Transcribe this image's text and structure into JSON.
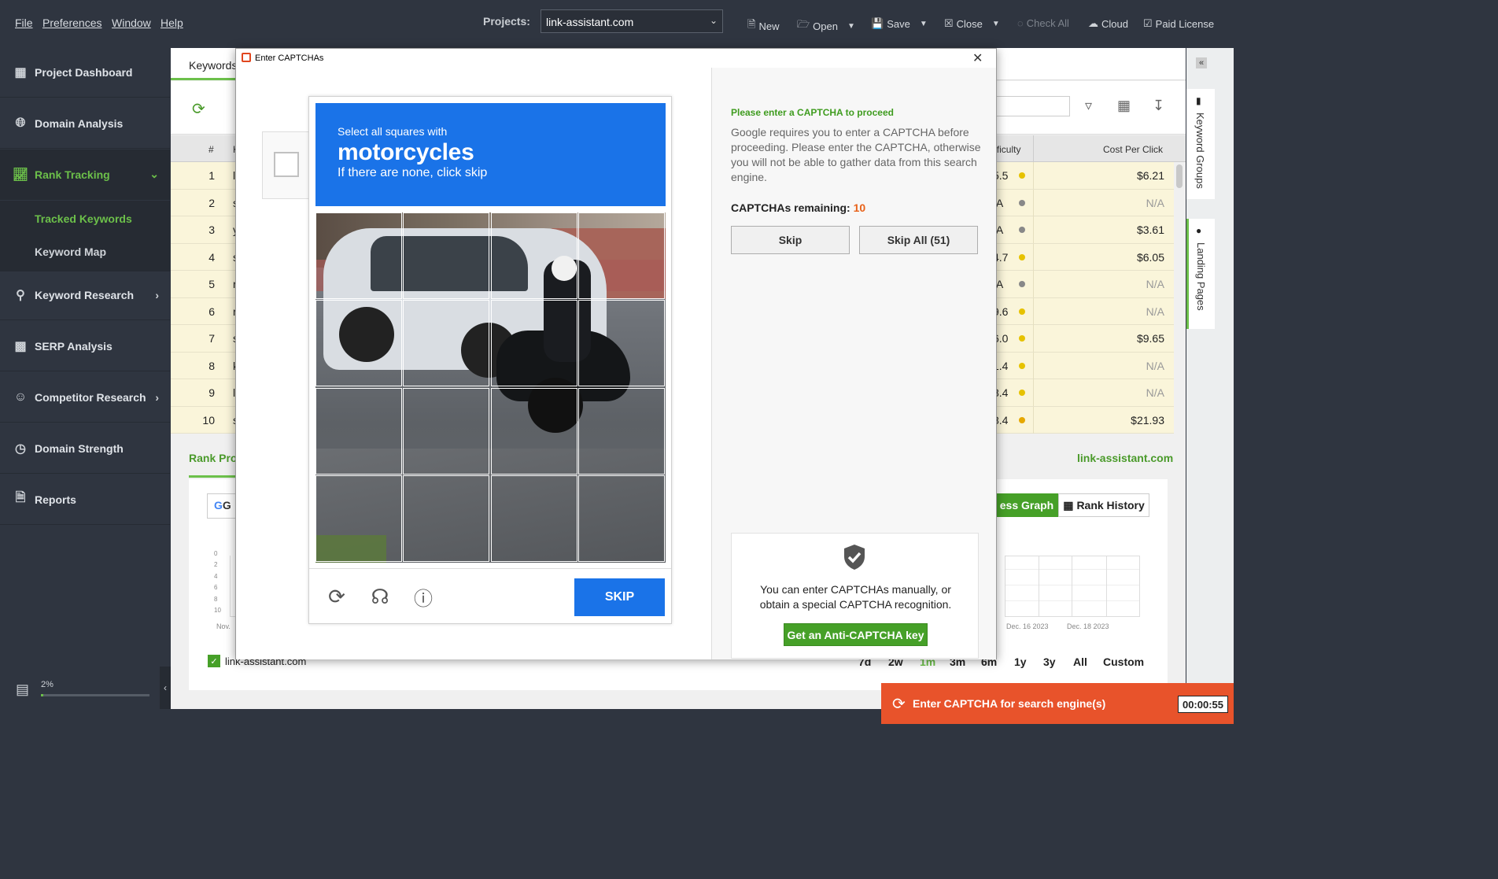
{
  "menu": {
    "file": "File",
    "preferences": "Preferences",
    "window": "Window",
    "help": "Help"
  },
  "projects": {
    "label": "Projects:",
    "value": "link-assistant.com"
  },
  "toolbar": {
    "new": "New",
    "open": "Open",
    "save": "Save",
    "close": "Close",
    "check_all": "Check All",
    "cloud": "Cloud",
    "paid_license": "Paid License"
  },
  "sidebar": {
    "items": [
      {
        "label": "Project Dashboard",
        "icon": "dashboard-icon"
      },
      {
        "label": "Domain Analysis",
        "icon": "globe-icon"
      },
      {
        "label": "Rank Tracking",
        "icon": "chart-line-icon"
      },
      {
        "label": "Keyword Research",
        "icon": "search-icon"
      },
      {
        "label": "SERP Analysis",
        "icon": "bar-chart-icon"
      },
      {
        "label": "Competitor Research",
        "icon": "user-icon"
      },
      {
        "label": "Domain Strength",
        "icon": "gauge-icon"
      },
      {
        "label": "Reports",
        "icon": "report-icon"
      }
    ],
    "sub_items": [
      "Tracked Keywords",
      "Keyword Map"
    ],
    "progress_label": "2%",
    "progress_value": 0.02
  },
  "main": {
    "tab": "Keywords",
    "table": {
      "col_num": "#",
      "col_h": "K",
      "col_difficulty": "ifficulty",
      "col_cpc": "Cost Per Click",
      "rows": [
        {
          "n": "1",
          "k": "l",
          "diff": "5.5",
          "dot": "#e6c200",
          "cpc": "$6.21"
        },
        {
          "n": "2",
          "k": "s",
          "diff": "/A",
          "dot": "#888888",
          "cpc": "N/A"
        },
        {
          "n": "3",
          "k": "y",
          "diff": "/A",
          "dot": "#888888",
          "cpc": "$3.61"
        },
        {
          "n": "4",
          "k": "s",
          "diff": "4.7",
          "dot": "#e6c200",
          "cpc": "$6.05"
        },
        {
          "n": "5",
          "k": "r",
          "diff": "/A",
          "dot": "#888888",
          "cpc": "N/A"
        },
        {
          "n": "6",
          "k": "r",
          "diff": "9.6",
          "dot": "#e6c200",
          "cpc": "N/A"
        },
        {
          "n": "7",
          "k": "s",
          "diff": "6.0",
          "dot": "#e6c200",
          "cpc": "$9.65"
        },
        {
          "n": "8",
          "k": "k",
          "diff": "1.4",
          "dot": "#e6c200",
          "cpc": "N/A"
        },
        {
          "n": "9",
          "k": "l",
          "diff": "8.4",
          "dot": "#e6c200",
          "cpc": "N/A"
        },
        {
          "n": "10",
          "k": "s",
          "diff": "8.4",
          "dot": "#e6a800",
          "cpc": "$21.93"
        }
      ]
    },
    "rank_progress_title": "Rank Pro",
    "domain": "link-assistant.com",
    "engine_partial": "G",
    "graph_tabs": {
      "progress": "ess Graph",
      "history": "Rank History"
    },
    "y_ticks": [
      "0",
      "2",
      "4",
      "6",
      "8",
      "10"
    ],
    "x_label_left": "Nov.",
    "x_labels": [
      "Dec. 16 2023",
      "Dec. 18 2023"
    ],
    "legend_item": "link-assistant.com",
    "ranges": [
      "7d",
      "2w",
      "1m",
      "3m",
      "6m",
      "1y",
      "3y",
      "All",
      "Custom"
    ],
    "active_range": "1m"
  },
  "right_rail": {
    "keyword_groups": "Keyword Groups",
    "landing_pages": "Landing Pages"
  },
  "modal": {
    "title": "Enter CAPTCHAs",
    "recaptcha": {
      "line1": "Select all squares with",
      "line2": "motorcycles",
      "line3": "If there are none, click skip",
      "skip": "SKIP"
    },
    "right": {
      "title": "Please enter a CAPTCHA to proceed",
      "text": "Google requires you to enter a CAPTCHA before proceeding. Please enter the CAPTCHA, otherwise you will not be able to gather data from this search engine.",
      "remaining_label": "CAPTCHAs remaining:",
      "remaining_value": "10",
      "skip": "Skip",
      "skip_all": "Skip All (51)",
      "anti_text": "You can enter CAPTCHAs manually, or obtain a special CAPTCHA recognition.",
      "anti_button": "Get an Anti-CAPTCHA key"
    }
  },
  "notification": {
    "text": "Enter CAPTCHA for search engine(s)",
    "timer": "00:00:55"
  },
  "colors": {
    "accent_green": "#6cc04a",
    "recaptcha_blue": "#1a73e8",
    "notify_orange": "#e8532b"
  }
}
